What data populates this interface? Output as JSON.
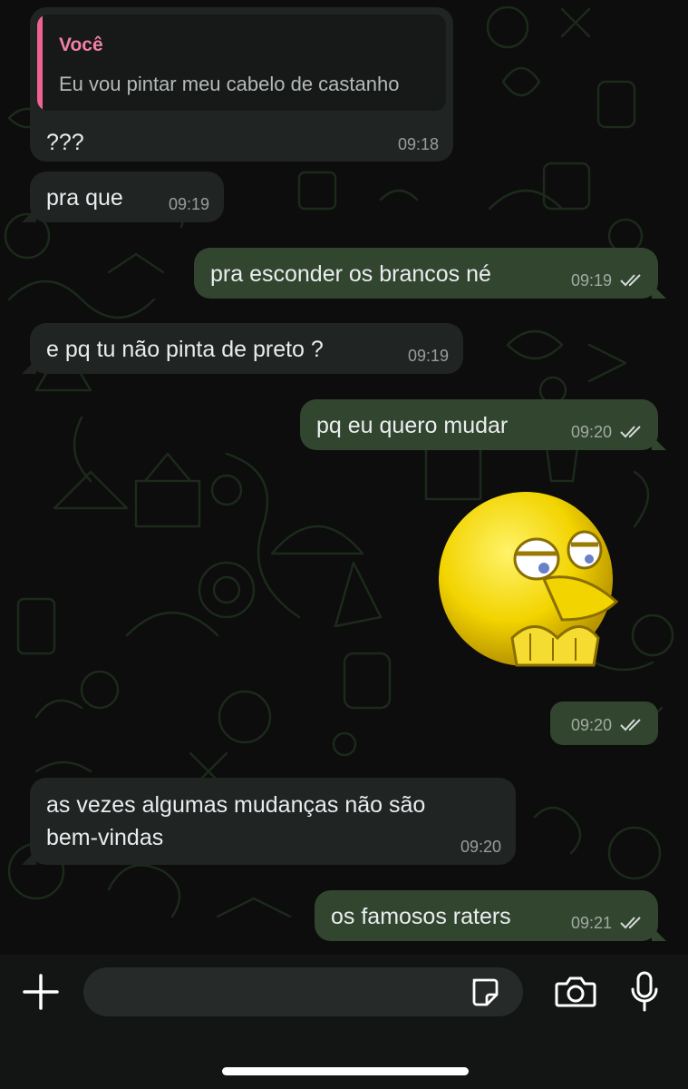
{
  "colors": {
    "incoming_bubble": "#202422",
    "outgoing_bubble": "#32452f",
    "quote_accent": "#f06292",
    "read_ticks": "#d5dbd8"
  },
  "messages": [
    {
      "direction": "incoming",
      "quote": {
        "author": "Você",
        "text": "Eu vou pintar meu cabelo de castanho"
      },
      "text": "???",
      "time": "09:18"
    },
    {
      "direction": "incoming",
      "text": "pra que",
      "time": "09:19"
    },
    {
      "direction": "outgoing",
      "text": "pra esconder os brancos né",
      "time": "09:19",
      "status": "read"
    },
    {
      "direction": "incoming",
      "text": "e pq tu não pinta de preto ?",
      "time": "09:19"
    },
    {
      "direction": "outgoing",
      "text": "pq eu quero mudar",
      "time": "09:20",
      "status": "read"
    },
    {
      "direction": "outgoing",
      "type": "sticker",
      "sticker": "yellow-pouting-emoji-sticker",
      "time": "09:20",
      "status": "read"
    },
    {
      "direction": "incoming",
      "text_lines": [
        "as vezes algumas mudanças não são",
        "bem-vindas"
      ],
      "time": "09:20"
    },
    {
      "direction": "outgoing",
      "text": "os famosos raters",
      "time": "09:21",
      "status": "read"
    }
  ],
  "composer": {
    "icons": [
      "plus-icon",
      "sticker-icon",
      "camera-icon",
      "microphone-icon"
    ]
  }
}
